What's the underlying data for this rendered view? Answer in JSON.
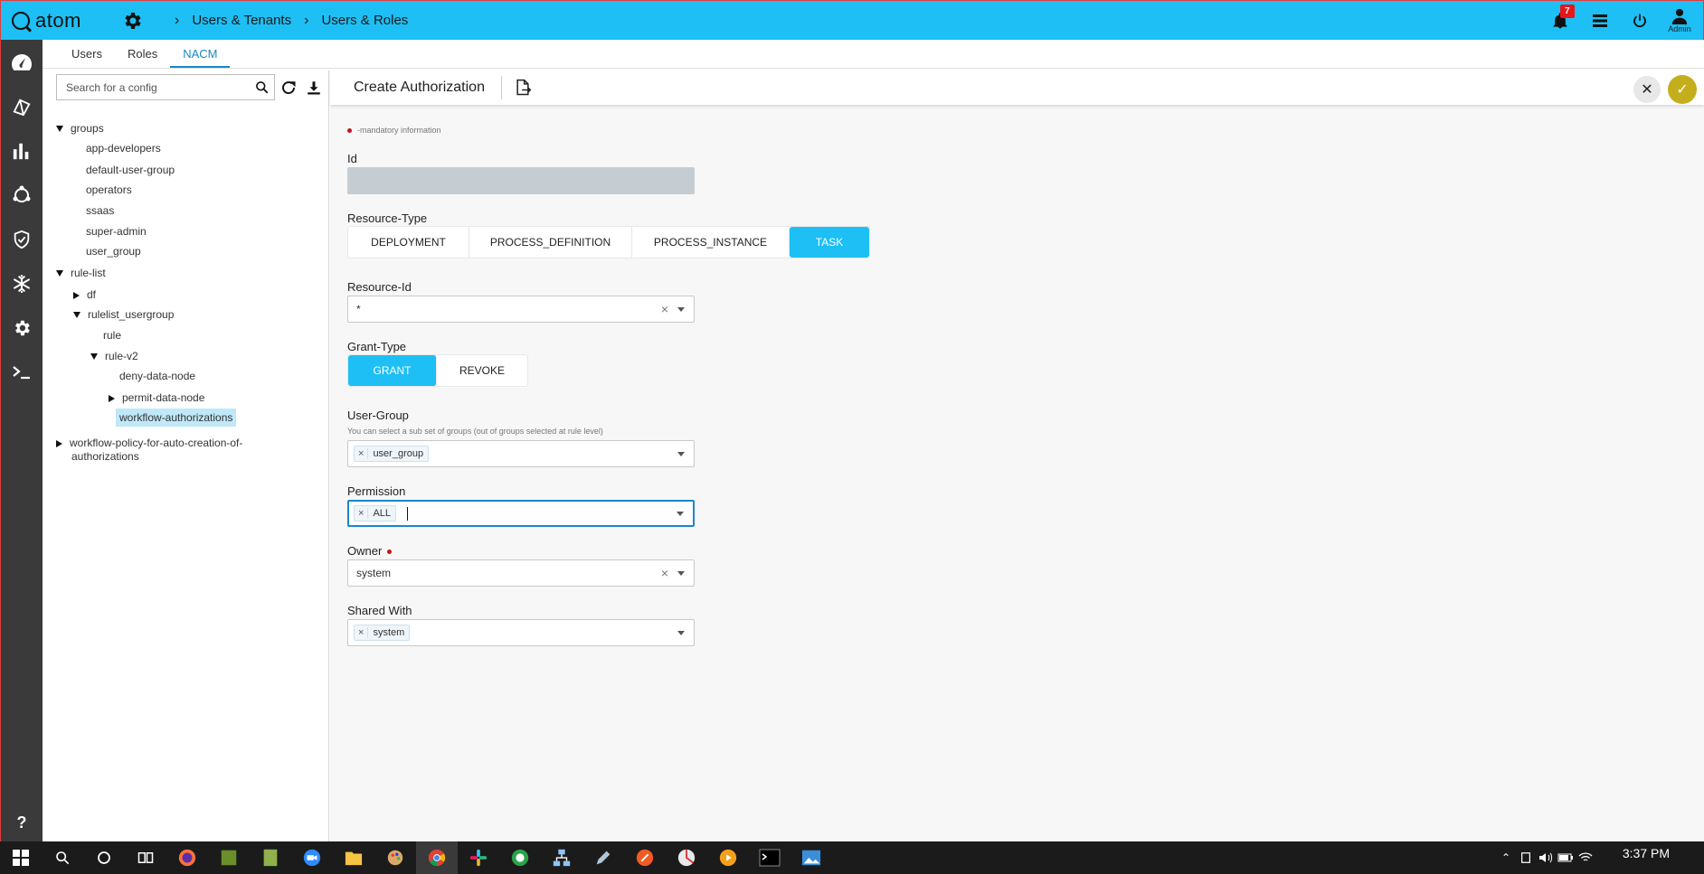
{
  "app": {
    "logo_text": "atom"
  },
  "breadcrumbs": [
    "Users & Tenants",
    "Users & Roles"
  ],
  "topbar": {
    "notification_count": "7",
    "user_label": "Admin"
  },
  "colors": {
    "brand": "#1dbff5",
    "rail": "#3a3a3a",
    "accent": "#1a87c9",
    "confirm": "#c4ae1d"
  },
  "subtabs": [
    {
      "label": "Users",
      "active": false
    },
    {
      "label": "Roles",
      "active": false
    },
    {
      "label": "NACM",
      "active": true
    }
  ],
  "tree_search": {
    "placeholder": "Search for a config"
  },
  "tree": {
    "groups": "groups",
    "app_developers": "app-developers",
    "default_user_group": "default-user-group",
    "operators": "operators",
    "ssaas": "ssaas",
    "super_admin": "super-admin",
    "user_group": "user_group",
    "rule_list": "rule-list",
    "df": "df",
    "rulelist_usergroup": "rulelist_usergroup",
    "rule": "rule",
    "rule_v2": "rule-v2",
    "deny_data_node": "deny-data-node",
    "permit_data_node": "permit-data-node",
    "workflow_authorizations": "workflow-authorizations",
    "workflow_policy_line1": "workflow-policy-for-auto-creation-of-",
    "workflow_policy_line2": "authorizations"
  },
  "form": {
    "title": "Create Authorization",
    "mandatory_note": "-mandatory information",
    "id_label": "Id",
    "id_value": "",
    "resource_type_label": "Resource-Type",
    "resource_types": [
      "DEPLOYMENT",
      "PROCESS_DEFINITION",
      "PROCESS_INSTANCE",
      "TASK"
    ],
    "resource_type_selected": "TASK",
    "resource_id_label": "Resource-Id",
    "resource_id_value": "*",
    "grant_type_label": "Grant-Type",
    "grant_types": [
      "GRANT",
      "REVOKE"
    ],
    "grant_type_selected": "GRANT",
    "user_group_label": "User-Group",
    "user_group_hint": "You can select a sub set of groups (out of groups selected at rule level)",
    "user_group_chip": "user_group",
    "permission_label": "Permission",
    "permission_chip": "ALL",
    "owner_label": "Owner",
    "owner_value": "system",
    "shared_with_label": "Shared With",
    "shared_with_chip": "system"
  },
  "taskbar": {
    "time": "3:37 PM"
  }
}
